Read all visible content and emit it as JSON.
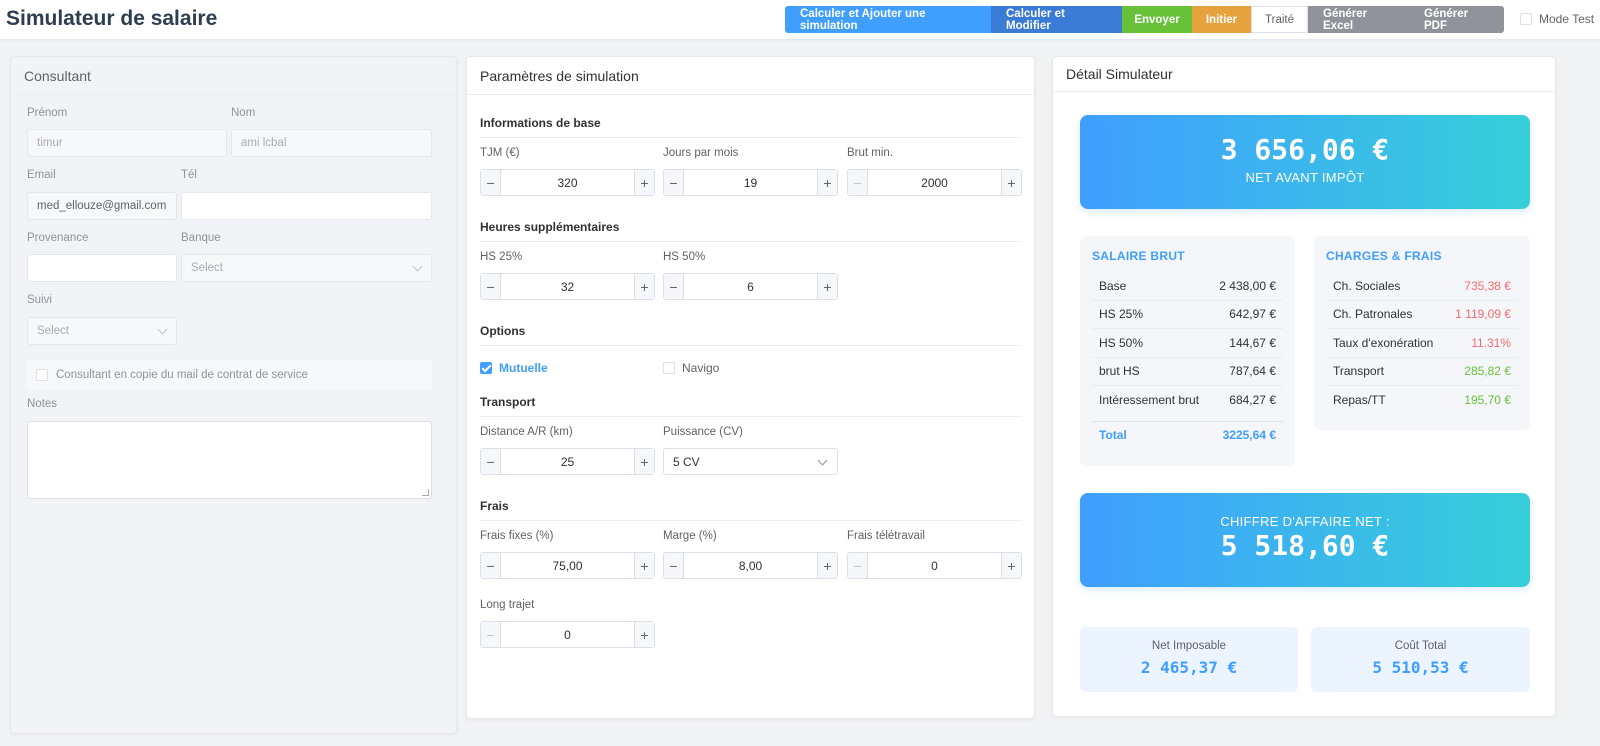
{
  "header": {
    "title": "Simulateur de salaire",
    "buttons": {
      "add": "Calculer et Ajouter une simulation",
      "modify": "Calculer et Modifier",
      "send": "Envoyer",
      "init": "Initier",
      "treated": "Traité",
      "excel": "Générer Excel",
      "pdf": "Générer PDF"
    },
    "mode_test": "Mode Test"
  },
  "consultant": {
    "title": "Consultant",
    "prenom_label": "Prénom",
    "prenom_value": "timur",
    "nom_label": "Nom",
    "nom_value": "ami lcbal",
    "email_label": "Email",
    "email_value": "med_ellouze@gmail.com",
    "tel_label": "Tél",
    "tel_value": "",
    "provenance_label": "Provenance",
    "provenance_value": "",
    "banque_label": "Banque",
    "banque_placeholder": "Select",
    "suivi_label": "Suivi",
    "suivi_placeholder": "Select",
    "copy_label": "Consultant en copie du mail de contrat de service",
    "notes_label": "Notes"
  },
  "params": {
    "title": "Paramètres de simulation",
    "base": {
      "title": "Informations de base",
      "tjm_label": "TJM (€)",
      "tjm": "320",
      "jours_label": "Jours par mois",
      "jours": "19",
      "brut_label": "Brut min.",
      "brut": "2000"
    },
    "hs": {
      "title": "Heures supplémentaires",
      "hs25_label": "HS 25%",
      "hs25": "32",
      "hs50_label": "HS 50%",
      "hs50": "6"
    },
    "options": {
      "title": "Options",
      "mutuelle": "Mutuelle",
      "navigo": "Navigo"
    },
    "transport": {
      "title": "Transport",
      "distance_label": "Distance A/R (km)",
      "distance": "25",
      "puissance_label": "Puissance (CV)",
      "puissance": "5 CV"
    },
    "frais": {
      "title": "Frais",
      "fixes_label": "Frais fixes (%)",
      "fixes": "75,00",
      "marge_label": "Marge (%)",
      "marge": "8,00",
      "tele_label": "Frais télétravail",
      "tele": "0",
      "trajet_label": "Long trajet",
      "trajet": "0"
    }
  },
  "detail": {
    "title": "Détail Simulateur",
    "net_amount": "3 656,06 €",
    "net_label": "NET AVANT IMPÔT",
    "brut": {
      "title": "SALAIRE BRUT",
      "rows": [
        {
          "label": "Base",
          "value": "2 438,00 €"
        },
        {
          "label": "HS 25%",
          "value": "642,97 €"
        },
        {
          "label": "HS 50%",
          "value": "144,67 €"
        },
        {
          "label": "brut HS",
          "value": "787,64 €"
        },
        {
          "label": "Intéressement brut",
          "value": "684,27 €"
        }
      ],
      "total_label": "Total",
      "total_value": "3225,64 €"
    },
    "charges": {
      "title": "CHARGES & FRAIS",
      "rows": [
        {
          "label": "Ch. Sociales",
          "value": "735,38 €"
        },
        {
          "label": "Ch. Patronales",
          "value": "1 119,09 €"
        },
        {
          "label": "Taux d'exonération",
          "value": "11.31%"
        },
        {
          "label": "Transport",
          "value": "285,82 €"
        },
        {
          "label": "Repas/TT",
          "value": "195,70 €"
        }
      ]
    },
    "ca_label": "CHIFFRE D'AFFAIRE NET :",
    "ca_amount": "5 518,60 €",
    "net_imposable_label": "Net Imposable",
    "net_imposable": "2 465,37 €",
    "cout_total_label": "Coût Total",
    "cout_total": "5 510,53 €"
  }
}
